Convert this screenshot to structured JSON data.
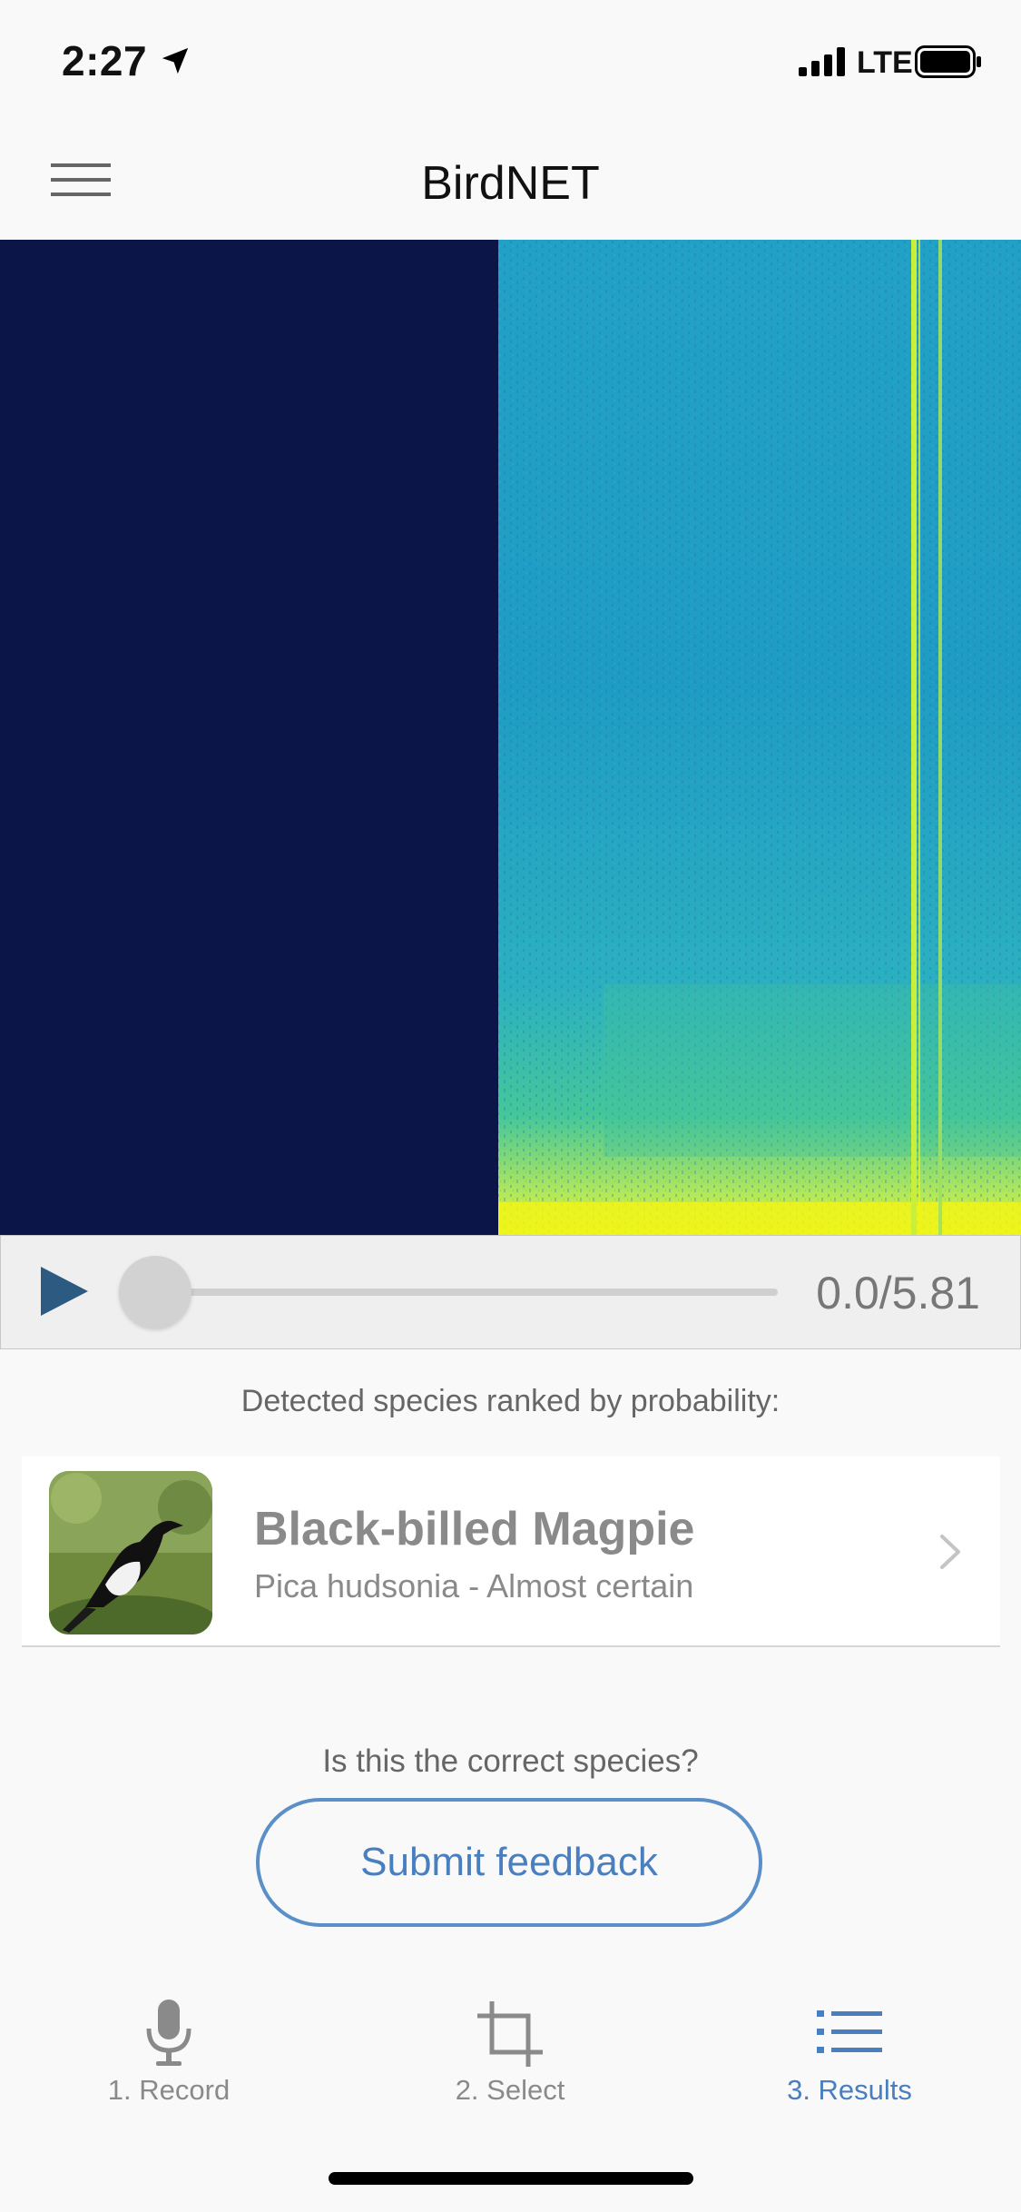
{
  "status_bar": {
    "time": "2:27",
    "network": "LTE"
  },
  "header": {
    "title": "BirdNET",
    "menu_icon": "hamburger-icon"
  },
  "spectrogram": {
    "empty_color": "#0c1548",
    "colormap": [
      "#2d6fb4",
      "#20a4c8",
      "#41c49b",
      "#e9f51f"
    ]
  },
  "player": {
    "play_icon": "play-icon",
    "time": "0.0/5.81",
    "progress": 0.0
  },
  "results": {
    "caption": "Detected species ranked by probability:",
    "items": [
      {
        "common_name": "Black-billed Magpie",
        "detail": "Pica hudsonia - Almost certain",
        "chevron_icon": "chevron-right-icon"
      }
    ]
  },
  "feedback": {
    "question": "Is this the correct species?",
    "button_label": "Submit feedback"
  },
  "tabs": [
    {
      "label": "1. Record",
      "icon": "microphone-icon",
      "active": false
    },
    {
      "label": "2. Select",
      "icon": "crop-icon",
      "active": false
    },
    {
      "label": "3. Results",
      "icon": "list-icon",
      "active": true
    }
  ],
  "colors": {
    "accent": "#4a7fbf",
    "play_button": "#2c5a80"
  }
}
